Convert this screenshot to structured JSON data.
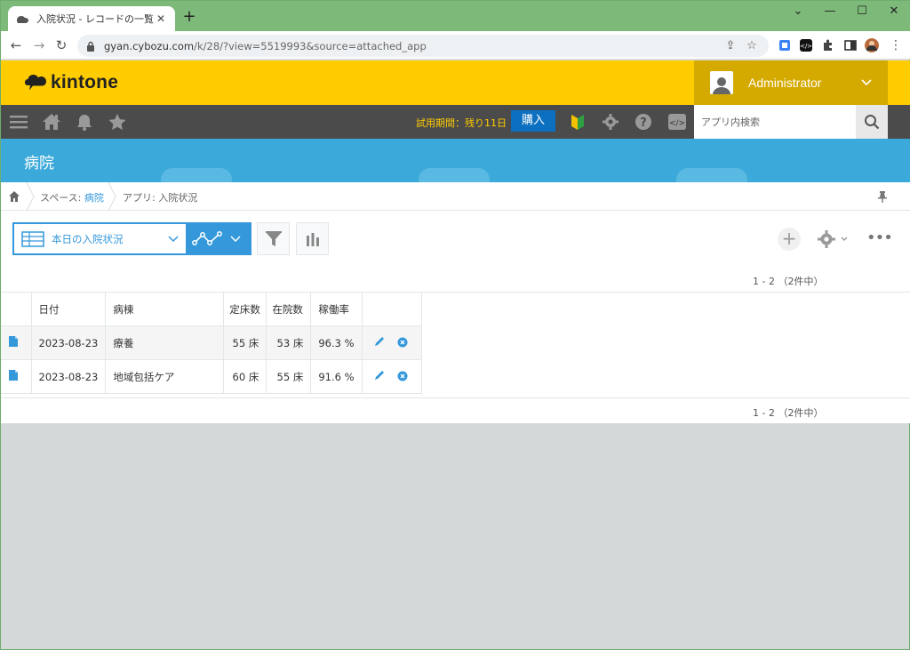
{
  "browser": {
    "tab_title": "入院状況 - レコードの一覧",
    "url_host": "gyan.cybozu.com",
    "url_path": "/k/28/?view=5519993&source=attached_app"
  },
  "header": {
    "brand": "kintone",
    "user_name": "Administrator",
    "trial_text": "試用期間：残り11日",
    "buy_label": "購入",
    "app_search_placeholder": "アプリ内検索"
  },
  "space": {
    "title": "病院"
  },
  "breadcrumb": {
    "space_prefix": "スペース: ",
    "space_name": "病院",
    "app_label": "アプリ: 入院状況"
  },
  "view": {
    "selected_view": "本日の入院状況"
  },
  "pagination": {
    "text": "1 - 2 （2件中）"
  },
  "table": {
    "columns": [
      "日付",
      "病棟",
      "定床数",
      "在院数",
      "稼働率"
    ],
    "rows": [
      {
        "date": "2023-08-23",
        "ward": "療養",
        "beds": "55 床",
        "inpatients": "53 床",
        "rate": "96.3 %"
      },
      {
        "date": "2023-08-23",
        "ward": "地域包括ケア",
        "beds": "60 床",
        "inpatients": "55 床",
        "rate": "91.6 %"
      }
    ]
  },
  "colors": {
    "header_yellow": "#ffcc00",
    "accent_blue": "#3498db",
    "banner_blue": "#3ba9d9",
    "bar_dark": "#4b4b4b"
  },
  "icons": [
    "home-icon",
    "bell-icon",
    "star-icon",
    "menu-icon",
    "beginner-icon",
    "gear-icon",
    "help-icon",
    "code-icon",
    "search-icon",
    "filter-icon",
    "chart-icon",
    "edit-icon",
    "delete-icon",
    "document-icon",
    "pin-icon"
  ]
}
